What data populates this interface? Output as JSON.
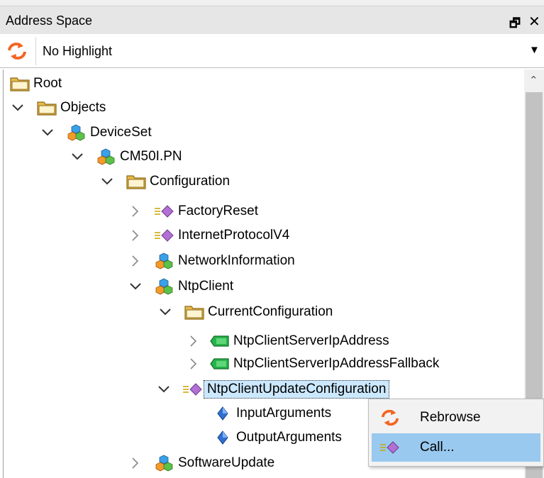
{
  "panel": {
    "title": "Address Space"
  },
  "toolbar": {
    "highlight_value": "No Highlight"
  },
  "tree": {
    "root": "Root",
    "objects": "Objects",
    "device_set": "DeviceSet",
    "device": "CM50I.PN",
    "configuration": "Configuration",
    "factory_reset": "FactoryReset",
    "internet_protocol": "InternetProtocolV4",
    "network_information": "NetworkInformation",
    "ntp_client": "NtpClient",
    "current_configuration": "CurrentConfiguration",
    "server_ip": "NtpClientServerIpAddress",
    "server_ip_fallback": "NtpClientServerIpAddressFallback",
    "update_configuration": "NtpClientUpdateConfiguration",
    "input_arguments": "InputArguments",
    "output_arguments": "OutputArguments",
    "software_update": "SoftwareUpdate"
  },
  "context_menu": {
    "rebrowse": "Rebrowse",
    "call": "Call..."
  },
  "colors": {
    "selection": "#cce8ff",
    "menu_highlight": "#99c9ef",
    "refresh_icon": "#f26522"
  }
}
